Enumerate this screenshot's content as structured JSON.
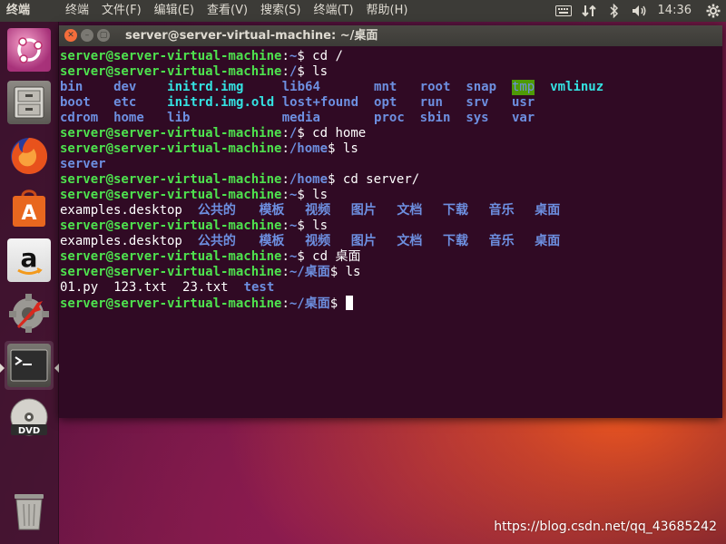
{
  "top_panel": {
    "app_name": "终端",
    "menu": [
      "终端",
      "文件(F)",
      "编辑(E)",
      "查看(V)",
      "搜索(S)",
      "终端(T)",
      "帮助(H)"
    ],
    "clock": "14:36"
  },
  "launcher": {
    "items": [
      "ubuntu-dash",
      "files",
      "firefox",
      "ubuntu-software",
      "amazon",
      "system-settings",
      "terminal",
      "dvd",
      "trash"
    ]
  },
  "window": {
    "title": "server@server-virtual-machine: ~/桌面"
  },
  "terminal": {
    "prompt_user": "server@server-virtual-machine",
    "lines": [
      {
        "type": "prompt",
        "path": "~",
        "cmd": "cd /"
      },
      {
        "type": "prompt",
        "path": "/",
        "cmd": "ls"
      },
      {
        "type": "ls",
        "cols": [
          {
            "t": "bin",
            "c": "dir"
          },
          {
            "t": "dev",
            "c": "dir"
          },
          {
            "t": "initrd.img",
            "c": "sym"
          },
          {
            "t": "lib64",
            "c": "dir"
          },
          {
            "t": "mnt",
            "c": "dir"
          },
          {
            "t": "root",
            "c": "dir"
          },
          {
            "t": "snap",
            "c": "dir"
          },
          {
            "t": "tmp",
            "c": "tmp"
          },
          {
            "t": "vmlinuz",
            "c": "sym"
          }
        ]
      },
      {
        "type": "ls",
        "cols": [
          {
            "t": "boot",
            "c": "dir"
          },
          {
            "t": "etc",
            "c": "dir"
          },
          {
            "t": "initrd.img.old",
            "c": "sym"
          },
          {
            "t": "lost+found",
            "c": "dir"
          },
          {
            "t": "opt",
            "c": "dir"
          },
          {
            "t": "run",
            "c": "dir"
          },
          {
            "t": "srv",
            "c": "dir"
          },
          {
            "t": "usr",
            "c": "dir"
          }
        ]
      },
      {
        "type": "ls",
        "cols": [
          {
            "t": "cdrom",
            "c": "dir"
          },
          {
            "t": "home",
            "c": "dir"
          },
          {
            "t": "lib",
            "c": "dir"
          },
          {
            "t": "media",
            "c": "dir"
          },
          {
            "t": "proc",
            "c": "dir"
          },
          {
            "t": "sbin",
            "c": "dir"
          },
          {
            "t": "sys",
            "c": "dir"
          },
          {
            "t": "var",
            "c": "dir"
          }
        ]
      },
      {
        "type": "prompt",
        "path": "/",
        "cmd": "cd home"
      },
      {
        "type": "prompt",
        "path": "/home",
        "cmd": "ls"
      },
      {
        "type": "ls",
        "cols": [
          {
            "t": "server",
            "c": "dir"
          }
        ]
      },
      {
        "type": "prompt",
        "path": "/home",
        "cmd": "cd server/"
      },
      {
        "type": "prompt",
        "path": "~",
        "cmd": "ls"
      },
      {
        "type": "ls",
        "cols": [
          {
            "t": "examples.desktop",
            "c": "file"
          },
          {
            "t": "公共的",
            "c": "dir"
          },
          {
            "t": "模板",
            "c": "dir"
          },
          {
            "t": "视频",
            "c": "dir"
          },
          {
            "t": "图片",
            "c": "dir"
          },
          {
            "t": "文档",
            "c": "dir"
          },
          {
            "t": "下载",
            "c": "dir"
          },
          {
            "t": "音乐",
            "c": "dir"
          },
          {
            "t": "桌面",
            "c": "dir"
          }
        ]
      },
      {
        "type": "prompt",
        "path": "~",
        "cmd": "ls"
      },
      {
        "type": "ls",
        "cols": [
          {
            "t": "examples.desktop",
            "c": "file"
          },
          {
            "t": "公共的",
            "c": "dir"
          },
          {
            "t": "模板",
            "c": "dir"
          },
          {
            "t": "视频",
            "c": "dir"
          },
          {
            "t": "图片",
            "c": "dir"
          },
          {
            "t": "文档",
            "c": "dir"
          },
          {
            "t": "下载",
            "c": "dir"
          },
          {
            "t": "音乐",
            "c": "dir"
          },
          {
            "t": "桌面",
            "c": "dir"
          }
        ]
      },
      {
        "type": "prompt",
        "path": "~",
        "cmd": "cd 桌面"
      },
      {
        "type": "prompt",
        "path": "~/桌面",
        "cmd": "ls"
      },
      {
        "type": "ls",
        "cols": [
          {
            "t": "01.py",
            "c": "file"
          },
          {
            "t": "123.txt",
            "c": "file"
          },
          {
            "t": "23.txt",
            "c": "file"
          },
          {
            "t": "test",
            "c": "dir"
          }
        ]
      },
      {
        "type": "prompt",
        "path": "~/桌面",
        "cmd": "",
        "cursor": true
      }
    ]
  },
  "watermark": "https://blog.csdn.net/qq_43685242"
}
